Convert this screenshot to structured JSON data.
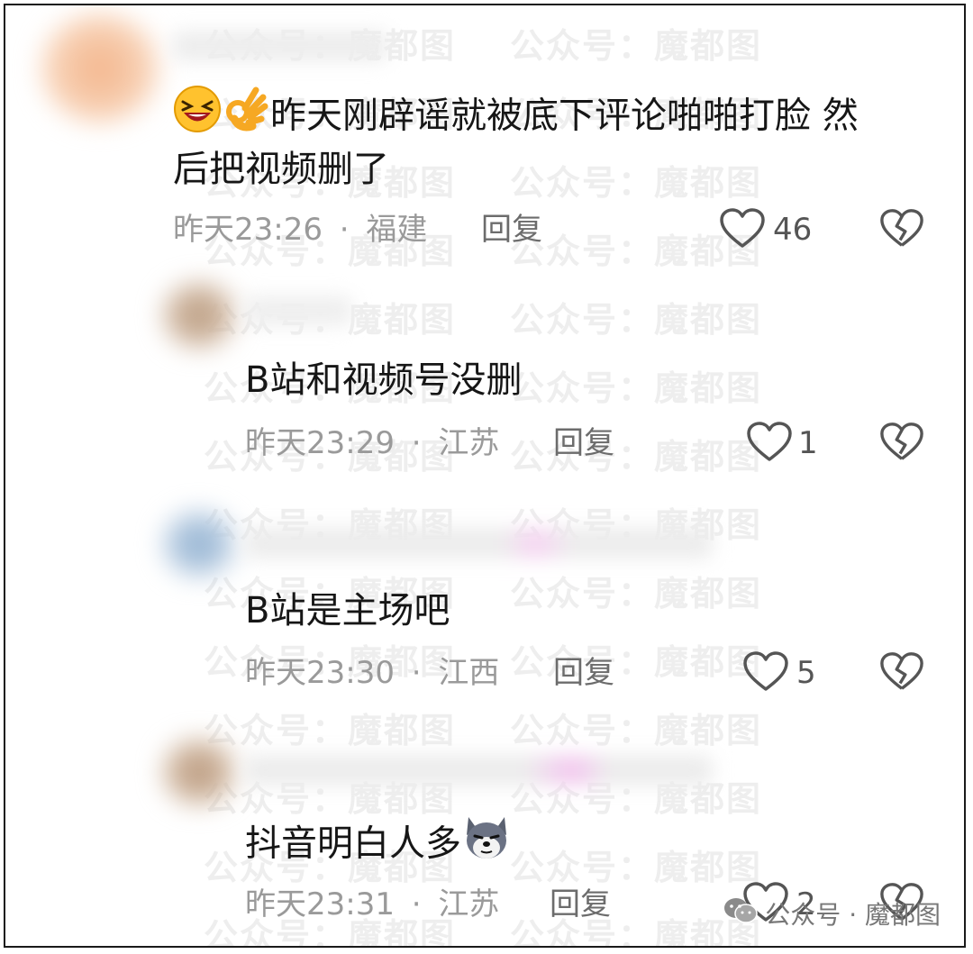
{
  "watermark": "公众号：魔都图",
  "comments": [
    {
      "text_line1": "昨天刚辟谣就被底下评论啪啪打脸 然",
      "text_line2": "后把视频删了",
      "emojis": [
        "laughing-face-emoji",
        "ok-hand-emoji"
      ],
      "time": "昨天23:26",
      "sep": "·",
      "location": "福建",
      "reply_label": "回复",
      "likes": "46"
    },
    {
      "text": "B站和视频号没删",
      "time": "昨天23:29",
      "sep": "·",
      "location": "江苏",
      "reply_label": "回复",
      "likes": "1"
    },
    {
      "text": "B站是主场吧",
      "time": "昨天23:30",
      "sep": "·",
      "location": "江西",
      "reply_label": "回复",
      "likes": "5"
    },
    {
      "text": "抖音明白人多",
      "emojis": [
        "dog-face-emoji"
      ],
      "time": "昨天23:31",
      "sep": "·",
      "location": "江苏",
      "reply_label": "回复",
      "likes": "2"
    }
  ],
  "footer": {
    "icon": "wechat-icon",
    "text": "公众号 · 魔都图"
  },
  "colors": {
    "text": "#161616",
    "meta": "#9a9a9a",
    "icon": "#555555"
  }
}
